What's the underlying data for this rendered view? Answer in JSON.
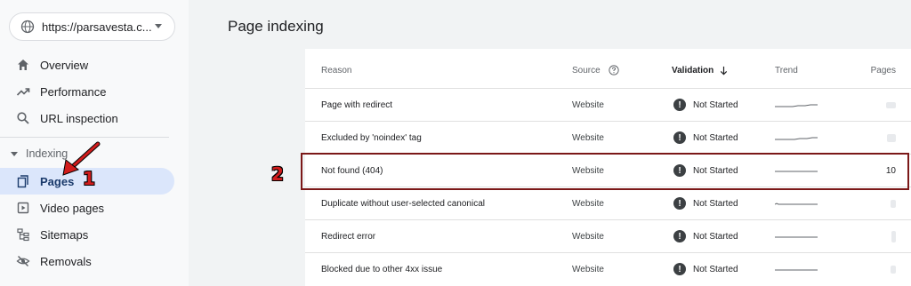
{
  "sidebar": {
    "property_url": "https://parsavesta.c...",
    "items": [
      {
        "label": "Overview",
        "icon": "home-icon"
      },
      {
        "label": "Performance",
        "icon": "trending-up-icon"
      },
      {
        "label": "URL inspection",
        "icon": "search-icon"
      }
    ],
    "section_label": "Indexing",
    "indexing_items": [
      {
        "label": "Pages",
        "icon": "pages-icon",
        "active": true
      },
      {
        "label": "Video pages",
        "icon": "video-icon"
      },
      {
        "label": "Sitemaps",
        "icon": "sitemap-icon"
      },
      {
        "label": "Removals",
        "icon": "removals-icon"
      }
    ]
  },
  "main": {
    "title": "Page indexing",
    "table": {
      "headers": {
        "reason": "Reason",
        "source": "Source",
        "validation": "Validation",
        "trend": "Trend",
        "pages": "Pages"
      },
      "rows": [
        {
          "reason": "Page with redirect",
          "source": "Website",
          "validation": "Not Started",
          "pages": ""
        },
        {
          "reason": "Excluded by 'noindex' tag",
          "source": "Website",
          "validation": "Not Started",
          "pages": ""
        },
        {
          "reason": "Not found (404)",
          "source": "Website",
          "validation": "Not Started",
          "pages": "10"
        },
        {
          "reason": "Duplicate without user-selected canonical",
          "source": "Website",
          "validation": "Not Started",
          "pages": ""
        },
        {
          "reason": "Redirect error",
          "source": "Website",
          "validation": "Not Started",
          "pages": ""
        },
        {
          "reason": "Blocked due to other 4xx issue",
          "source": "Website",
          "validation": "Not Started",
          "pages": ""
        }
      ]
    }
  },
  "annotations": {
    "badge_1": "1",
    "badge_2": "2"
  },
  "colors": {
    "active_bg": "#dbe6fb",
    "annotation_red": "#d21c1c",
    "highlight_border": "#7b1818"
  }
}
